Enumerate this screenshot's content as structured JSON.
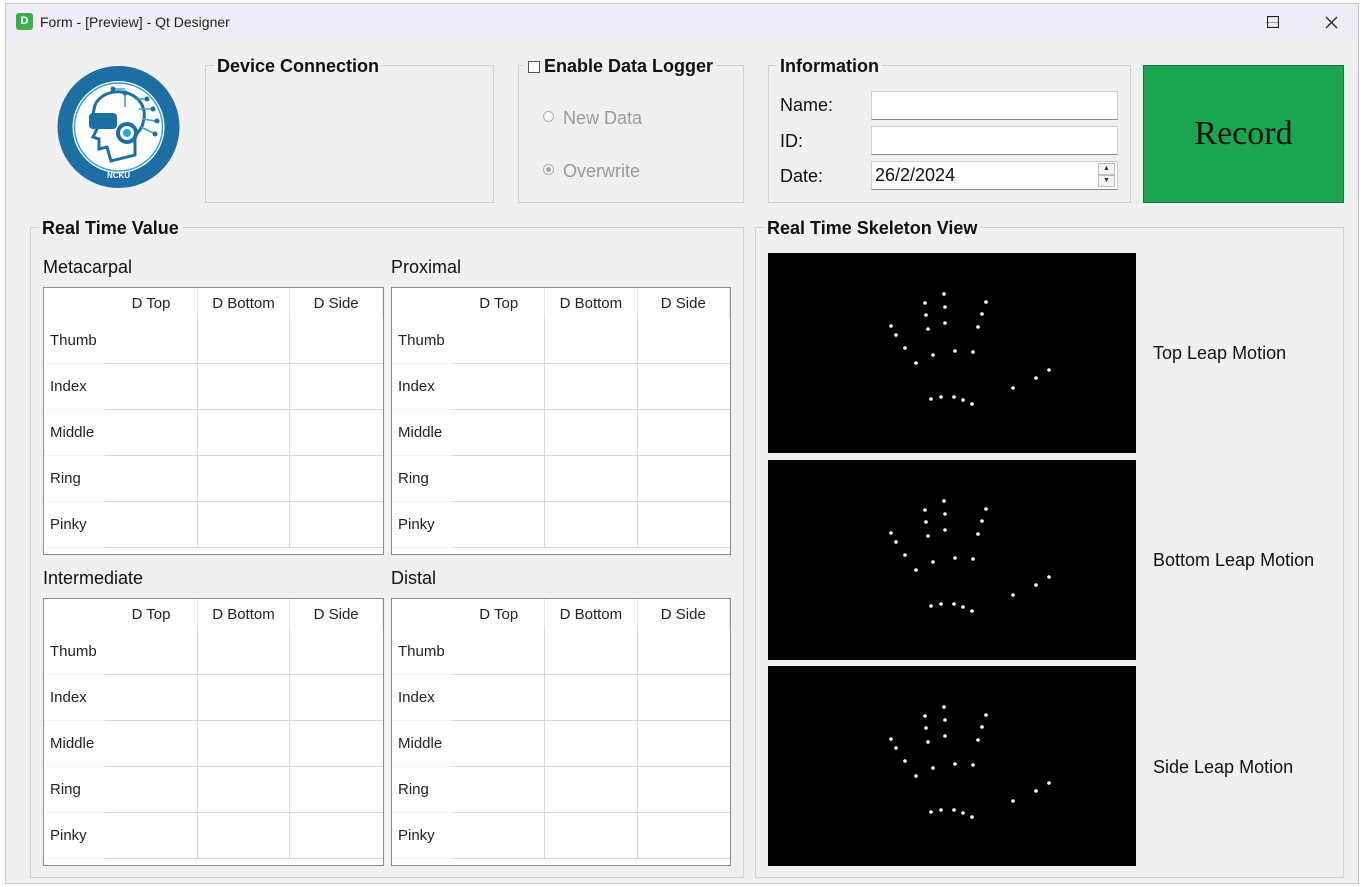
{
  "window": {
    "title": "Form - [Preview] - Qt Designer",
    "app_icon_letter": "D"
  },
  "logo": {
    "text_outer": "WEARABLE TECHNOLOGY AND MOBILE HEALTHCARE",
    "text_bottom": "NCKU",
    "colors": {
      "ring": "#1d6fa3",
      "accent": "#2aa6d6"
    }
  },
  "device_connection": {
    "title": "Device Connection"
  },
  "data_logger": {
    "title": "Enable Data Logger",
    "checked": false,
    "options": [
      "New Data",
      "Overwrite"
    ],
    "selected": "Overwrite"
  },
  "information": {
    "title": "Information",
    "name_label": "Name:",
    "name_value": "",
    "id_label": "ID:",
    "id_value": "",
    "date_label": "Date:",
    "date_value": "26/2/2024"
  },
  "record_button": {
    "label": "Record",
    "color": "#1aa550"
  },
  "real_time_value": {
    "title": "Real Time Value",
    "columns": [
      "D Top",
      "D Bottom",
      "D Side"
    ],
    "rows": [
      "Thumb",
      "Index",
      "Middle",
      "Ring",
      "Pinky"
    ],
    "tables": [
      {
        "title": "Metacarpal"
      },
      {
        "title": "Proximal"
      },
      {
        "title": "Intermediate"
      },
      {
        "title": "Distal"
      }
    ]
  },
  "skeleton_view": {
    "title": "Real Time Skeleton View",
    "views": [
      {
        "label": "Top Leap Motion"
      },
      {
        "label": "Bottom Leap Motion"
      },
      {
        "label": "Side Leap Motion"
      }
    ]
  }
}
